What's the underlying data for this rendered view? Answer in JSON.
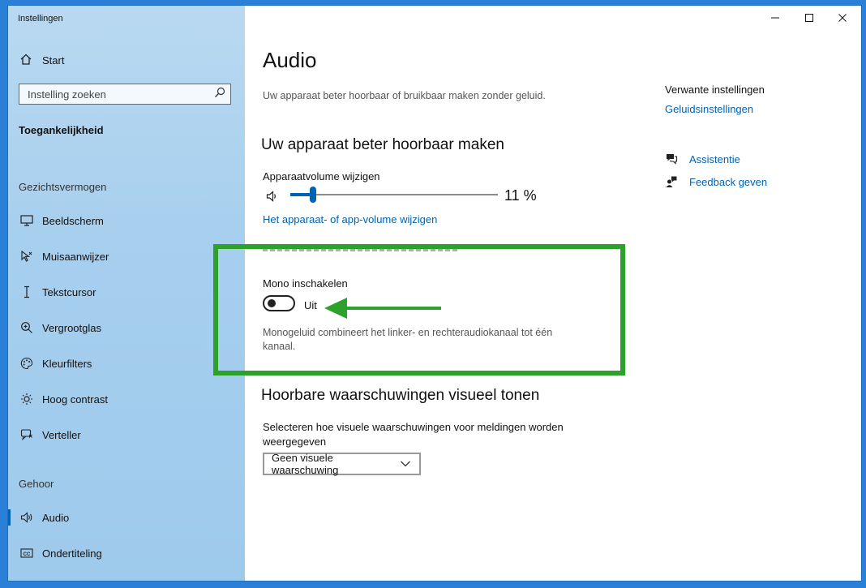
{
  "window": {
    "title": "Instellingen"
  },
  "sidebar": {
    "home_label": "Start",
    "search_placeholder": "Instelling zoeken",
    "section_title": "Toegankelijkheid",
    "groups": [
      {
        "label": "Gezichtsvermogen"
      },
      {
        "label": "Gehoor"
      }
    ],
    "items": [
      {
        "label": "Beeldscherm",
        "icon": "monitor-icon"
      },
      {
        "label": "Muisaanwijzer",
        "icon": "pointer-icon"
      },
      {
        "label": "Tekstcursor",
        "icon": "text-cursor-icon"
      },
      {
        "label": "Vergrootglas",
        "icon": "magnifier-icon"
      },
      {
        "label": "Kleurfilters",
        "icon": "palette-icon"
      },
      {
        "label": "Hoog contrast",
        "icon": "sun-icon"
      },
      {
        "label": "Verteller",
        "icon": "narrator-icon"
      },
      {
        "label": "Audio",
        "icon": "speaker-icon",
        "active": true
      },
      {
        "label": "Ondertiteling",
        "icon": "cc-icon"
      }
    ]
  },
  "main": {
    "title": "Audio",
    "description": "Uw apparaat beter hoorbaar of bruikbaar maken zonder geluid.",
    "section1": {
      "heading": "Uw apparaat beter hoorbaar maken",
      "volume_label": "Apparaatvolume wijzigen",
      "volume_value": "11 %",
      "volume_level": 0.11,
      "app_volume_link": "Het apparaat- of app-volume wijzigen",
      "mono_label": "Mono inschakelen",
      "mono_state": "Uit",
      "mono_on": false,
      "mono_description": "Monogeluid combineert het linker- en rechteraudiokanaal tot één kanaal."
    },
    "section2": {
      "heading": "Hoorbare waarschuwingen visueel tonen",
      "select_label": "Selecteren hoe visuele waarschuwingen voor meldingen worden weergegeven",
      "select_value": "Geen visuele waarschuwing"
    }
  },
  "related": {
    "title": "Verwante instellingen",
    "link": "Geluidsinstellingen",
    "help_link": "Assistentie",
    "feedback_link": "Feedback geven"
  },
  "colors": {
    "accent": "#0063b1",
    "highlight": "#2da12b",
    "sidebar_bg": "#a7cfee"
  }
}
